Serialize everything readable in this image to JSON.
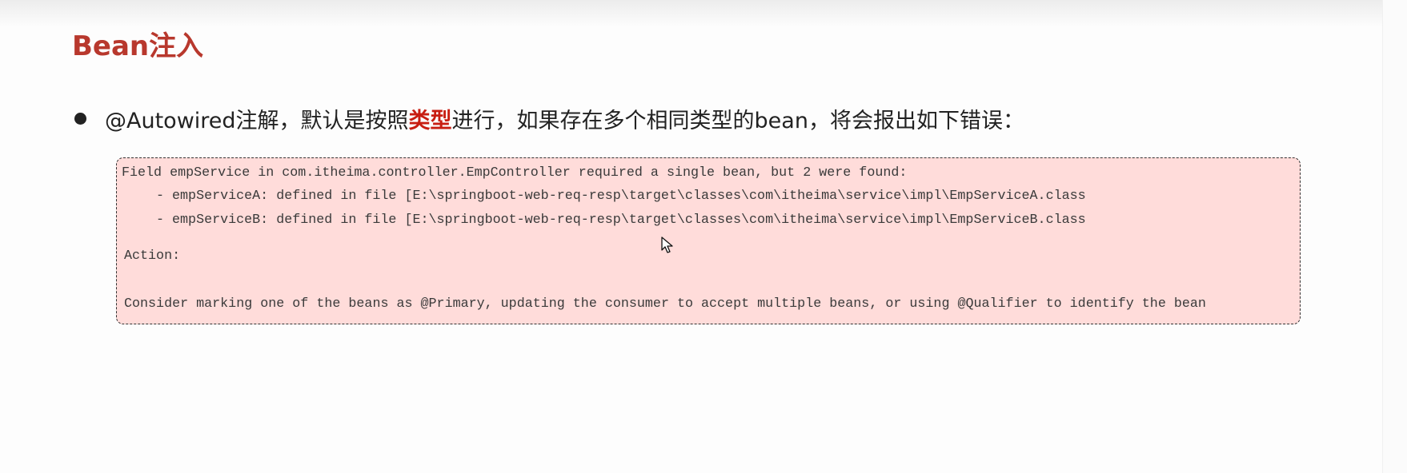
{
  "slide": {
    "title": "Bean注入",
    "bullet": {
      "prefix": "@Autowired注解，默认是按照",
      "highlight": "类型",
      "suffix": "进行，如果存在多个相同类型的bean，将会报出如下错误："
    }
  },
  "error_box": {
    "line1": "Field empService in com.itheima.controller.EmpController required a single bean, but 2 were found:",
    "line2": "- empServiceA: defined in file [E:\\springboot-web-req-resp\\target\\classes\\com\\itheima\\service\\impl\\EmpServiceA.class",
    "line3": "- empServiceB: defined in file [E:\\springboot-web-req-resp\\target\\classes\\com\\itheima\\service\\impl\\EmpServiceB.class",
    "line4": "Action:",
    "line5": "Consider marking one of the beans as @Primary, updating the consumer to accept multiple beans, or using @Qualifier to identify the bean"
  },
  "colors": {
    "title": "#b8382d",
    "highlight": "#c81e12",
    "error_background": "#ffdcda"
  },
  "icons": {
    "bullet": "bullet-dot-icon",
    "cursor": "mouse-pointer-icon"
  }
}
